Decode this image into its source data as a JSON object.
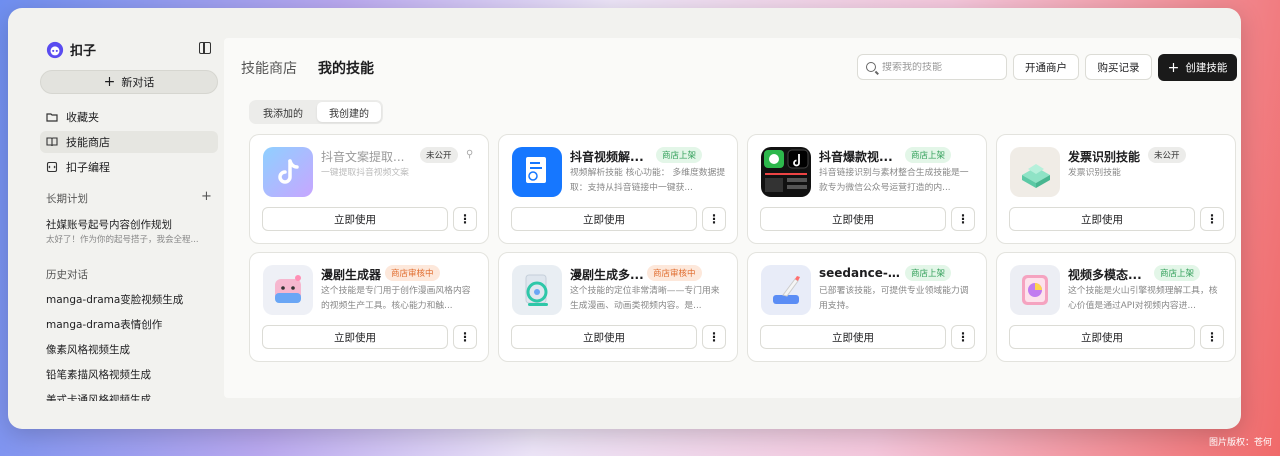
{
  "sidebar": {
    "brand": "扣子",
    "new_chat": "新对话",
    "nav": [
      {
        "label": "收藏夹"
      },
      {
        "label": "技能商店"
      },
      {
        "label": "扣子编程"
      }
    ],
    "plans_title": "长期计划",
    "plan": {
      "title": "社媒账号起号内容创作规划",
      "subtitle": "太好了！作为你的起号搭子，我会全程..."
    },
    "history_title": "历史对话",
    "history": [
      "manga-drama变脸视频生成",
      "manga-drama表情创作",
      "像素风格视频生成",
      "铅笔素描风格视频生成",
      "美式卡通风格视频生成"
    ]
  },
  "main": {
    "tab_store": "技能商店",
    "tab_mine": "我的技能",
    "search_placeholder": "搜索我的技能",
    "btn_merchant": "开通商户",
    "btn_purchases": "购买记录",
    "btn_create": "创建技能",
    "seg_added": "我添加的",
    "seg_created": "我创建的",
    "use_label": "立即使用",
    "cards": [
      {
        "title": "抖音文案提取...",
        "badge": "未公开",
        "badge_type": "gray",
        "desc": "一键提取抖音视频文案",
        "icon": "tiktok-icon",
        "dim": true
      },
      {
        "title": "抖音视频解...",
        "badge": "商店上架",
        "badge_type": "green",
        "desc": "视频解析技能 核心功能： 多维度数据提取：支持从抖音链接中一键获...",
        "icon": "document-icon"
      },
      {
        "title": "抖音爆款视...",
        "badge": "商店上架",
        "badge_type": "green",
        "desc": "抖音链接识别与素材整合生成技能是一款专为微信公众号运营打造的内...",
        "icon": "wechat-icon"
      },
      {
        "title": "发票识别技能",
        "badge": "未公开",
        "badge_type": "gray",
        "desc": "发票识别技能",
        "icon": "stamp-icon"
      },
      {
        "title": "漫剧生成器",
        "badge": "商店审核中",
        "badge_type": "orange",
        "desc": "这个技能是专门用于创作漫画风格内容的视频生产工具。核心能力和触...",
        "icon": "character-icon"
      },
      {
        "title": "漫剧生成多...",
        "badge": "商店审核中",
        "badge_type": "orange",
        "desc": "这个技能的定位非常清晰——专门用来生成漫画、动画类视频内容。是...",
        "icon": "film-reel-icon"
      },
      {
        "title": "seedance-vi...",
        "badge": "商店上架",
        "badge_type": "green",
        "desc": "已部署该技能，可提供专业领域能力调用支持。",
        "icon": "brush-icon"
      },
      {
        "title": "视频多模态...",
        "badge": "商店上架",
        "badge_type": "green",
        "desc": "这个技能是火山引擎视频理解工具，核心价值是通过API对视频内容进...",
        "icon": "video-analysis-icon"
      }
    ]
  },
  "credit": "图片版权：苍何"
}
